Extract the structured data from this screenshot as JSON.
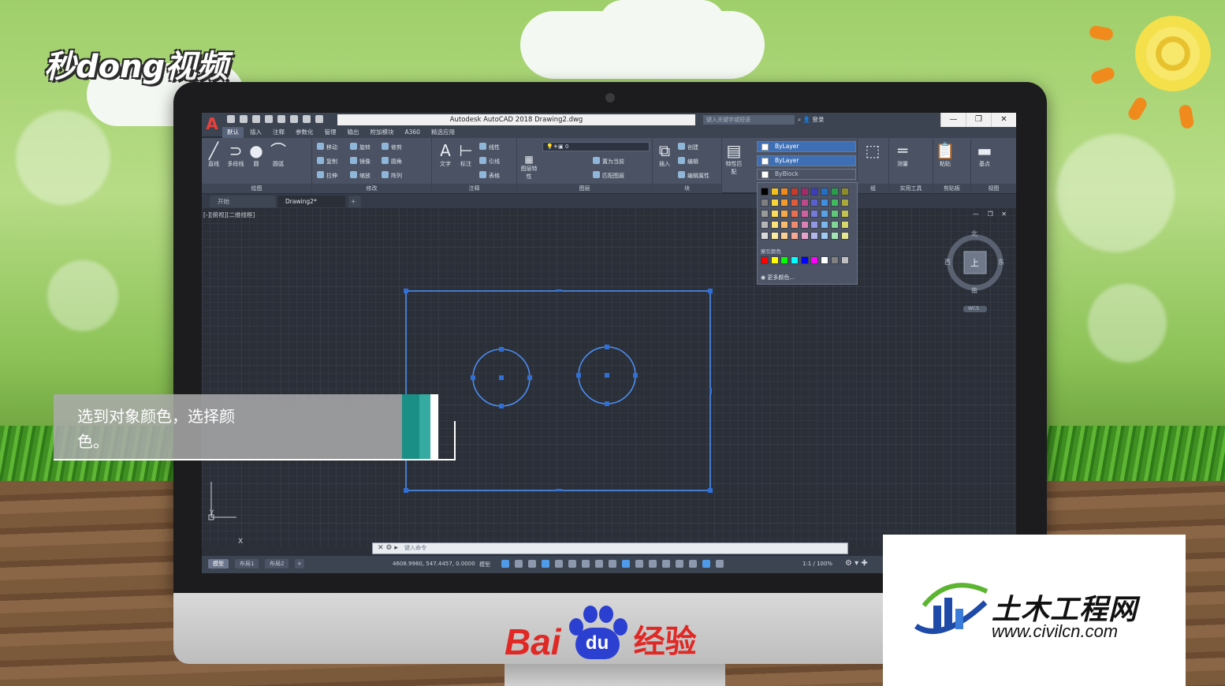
{
  "brand": {
    "logo_text": "秒dong视频"
  },
  "window": {
    "title": "Autodesk AutoCAD 2018   Drawing2.dwg",
    "search_placeholder": "键入关键字或短语",
    "login_label": "登录"
  },
  "menu_tabs": [
    "默认",
    "插入",
    "注释",
    "参数化",
    "管理",
    "输出",
    "附加模块",
    "A360",
    "精选应用"
  ],
  "ribbon": {
    "draw": {
      "label": "绘图",
      "tools": [
        "直线",
        "多段线",
        "圆",
        "圆弧"
      ]
    },
    "modify": {
      "label": "修改",
      "tools": [
        "移动",
        "旋转",
        "修剪",
        "复制",
        "镜像",
        "圆角",
        "拉伸",
        "缩放",
        "阵列"
      ]
    },
    "annotation": {
      "label": "注释",
      "tools": [
        "文字",
        "标注",
        "线性",
        "引线",
        "表格"
      ]
    },
    "layers": {
      "label": "图层",
      "tools": [
        "图层特性",
        "置为当前",
        "匹配图层"
      ],
      "current_layer": "0"
    },
    "block": {
      "label": "块",
      "tools": [
        "插入",
        "创建",
        "编辑",
        "编辑属性"
      ]
    },
    "properties": {
      "label": "特性匹配",
      "combo1": "ByLayer",
      "combo2": "ByLayer",
      "combo3": "ByBlock"
    },
    "groups": {
      "label": "组"
    },
    "utilities": {
      "label": "实用工具",
      "tool": "测量"
    },
    "clipboard": {
      "label": "剪贴板",
      "tool": "粘贴"
    },
    "view": {
      "label": "视图",
      "tool": "基点"
    }
  },
  "doc_tabs": [
    "开始",
    "Drawing2*"
  ],
  "viewport": {
    "label": "[-][俯视][二维线框]",
    "viewcube": {
      "top": "上",
      "north": "北",
      "south": "南",
      "east": "东",
      "west": "西",
      "wcs": "WCS"
    },
    "ucs_x": "X",
    "ucs_y": "Y"
  },
  "color_dropdown": {
    "index_label": "索引颜色",
    "more_label": "更多颜色...",
    "palette_rows": [
      [
        "#000000",
        "#f2c01d",
        "#ef8a18",
        "#c83b2b",
        "#a42b6a",
        "#3d3fb8",
        "#236fc6",
        "#2a9d4b",
        "#8b8b2a"
      ],
      [
        "#7f7f7f",
        "#f7d43a",
        "#f49a2a",
        "#e05b39",
        "#c0478a",
        "#5a5fd0",
        "#3f8ee0",
        "#40b85e",
        "#a9a93a"
      ],
      [
        "#9a9a9a",
        "#f9dc5a",
        "#f7a94a",
        "#ea6f50",
        "#d061a0",
        "#7579da",
        "#5aa2e8",
        "#5dc878",
        "#c2c24e"
      ],
      [
        "#b5b5b5",
        "#fbe37a",
        "#f9bb6a",
        "#f08a6c",
        "#dc80b6",
        "#9295e4",
        "#7ab6ee",
        "#7fd695",
        "#d6d66a"
      ],
      [
        "#d8d8d8",
        "#fdeba0",
        "#fbcf92",
        "#f5a892",
        "#e7a2cc",
        "#b2b4ec",
        "#9fcaf4",
        "#a4e4b4",
        "#e6e690"
      ]
    ],
    "index_colors": [
      "#ff0000",
      "#ffff00",
      "#00ff00",
      "#00ffff",
      "#0000ff",
      "#ff00ff",
      "#ffffff",
      "#808080",
      "#c0c0c0"
    ]
  },
  "command_line": {
    "placeholder": "键入命令"
  },
  "status": {
    "layout_tabs": [
      "模型",
      "布局1",
      "布局2"
    ],
    "coords": "4608.9960, 547.4457, 0.0000",
    "space": "模型",
    "scale": "1:1 / 100%"
  },
  "subtitle": {
    "text": "选到对象颜色，选择颜\n色。"
  },
  "baidu": {
    "bai": "Bai",
    "du": "du",
    "jingyan": "经验"
  },
  "watermark": {
    "name": "土木工程网",
    "url": "www.civilcn.com"
  },
  "colors": {
    "grip_blue": "#2f6fd6",
    "geometry_blue": "#4a8df0",
    "teal_1": "#1a8f86",
    "teal_2": "#35aaa0",
    "baidu_red": "#e02825",
    "baidu_blue": "#2b3fd1"
  }
}
